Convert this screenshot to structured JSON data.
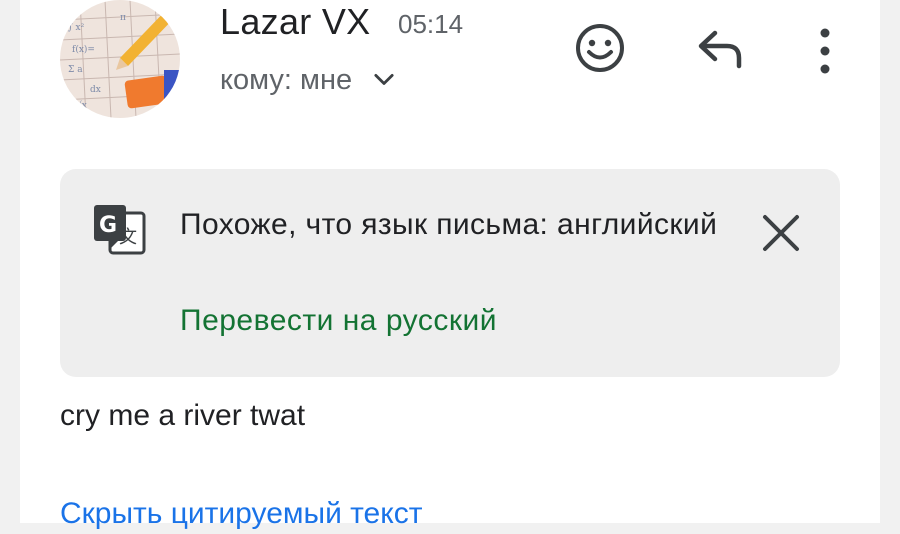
{
  "header": {
    "sender_name": "Lazar VX",
    "time": "05:14",
    "recipient": "кому: мне"
  },
  "icons": {
    "avatar": "sender-avatar",
    "recipient_toggle": "chevron-down-icon",
    "emoji": "smiley-face-icon",
    "reply": "reply-arrow-icon",
    "more": "vertical-dots-icon",
    "translate": "google-translate-icon",
    "close": "close-icon"
  },
  "translate_banner": {
    "message": "Похоже, что язык письма: английский",
    "action": "Перевести на русский"
  },
  "message": {
    "body": "cry me a river twat",
    "hide_quoted": "Скрыть цитируемый текст"
  },
  "colors": {
    "link_green": "#137333",
    "link_blue": "#1a73e8",
    "banner_bg": "#eeeeee",
    "text_primary": "#202124",
    "text_secondary": "#5f6368"
  }
}
